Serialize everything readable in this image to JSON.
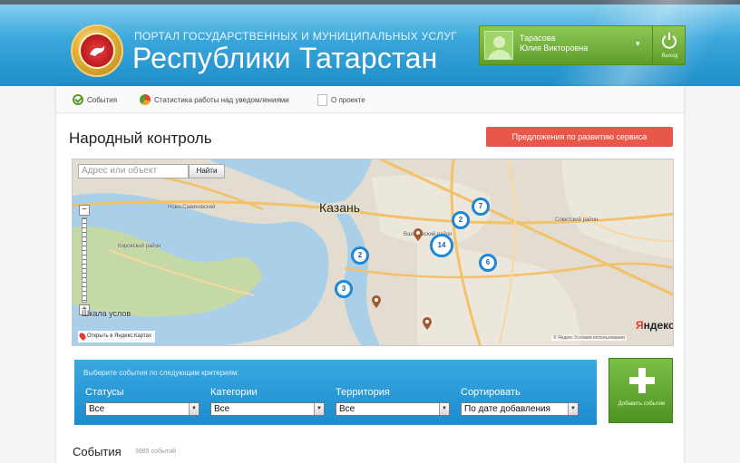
{
  "header": {
    "portal_subtitle": "ПОРТАЛ ГОСУДАРСТВЕННЫХ И МУНИЦИПАЛЬНЫХ УСЛУГ",
    "portal_title": "Республики Татарстан",
    "user_name_line1": "Тарасова",
    "user_name_line2": "Юлия Викторовна",
    "user_chevron": "▾",
    "logout_label": "Выход"
  },
  "nav": {
    "items": [
      {
        "label": "События",
        "icon": "check-circle-icon"
      },
      {
        "label": "Статистика работы над уведомлениями",
        "icon": "pie-chart-icon"
      },
      {
        "label": "О проекте",
        "icon": "document-icon"
      }
    ]
  },
  "main": {
    "title": "Народный контроль",
    "proposal_button": "Предложения по развитию сервиса"
  },
  "map": {
    "search_placeholder": "Адрес или объект",
    "find_button": "Найти",
    "city_label": "Казань",
    "districts": [
      "Ново-Савиновский",
      "Советский район",
      "Вахитовский район",
      "Кировский район"
    ],
    "scale_label": "Шкала услов",
    "zoom_in": "+",
    "zoom_out": "−",
    "clusters": [
      "7",
      "2",
      "14",
      "2",
      "6",
      "3"
    ],
    "yandex_link": "Открыть в Яндекс.Картах",
    "logo_red": "Я",
    "logo_black": "ндекс",
    "copyright": "© Яндекс  Условия использования"
  },
  "filter": {
    "hint": "Выберите события по следующим критериям:",
    "statuses_label": "Статусы",
    "statuses_value": "Все",
    "categories_label": "Категории",
    "categories_value": "Все",
    "territory_label": "Территория",
    "territory_value": "Все",
    "sort_label": "Сортировать",
    "sort_value": "По дате добавления",
    "select_arrow": "▼"
  },
  "add_event": {
    "label": "Добавить событие"
  },
  "events": {
    "title": "События",
    "count": "3985 событий"
  },
  "colors": {
    "header_blue": "#1f8fc9",
    "user_green": "#5f9e2b",
    "proposal_red": "#e8574a",
    "filter_blue": "#1b8ccf",
    "cluster_blue": "#1e88d6"
  }
}
